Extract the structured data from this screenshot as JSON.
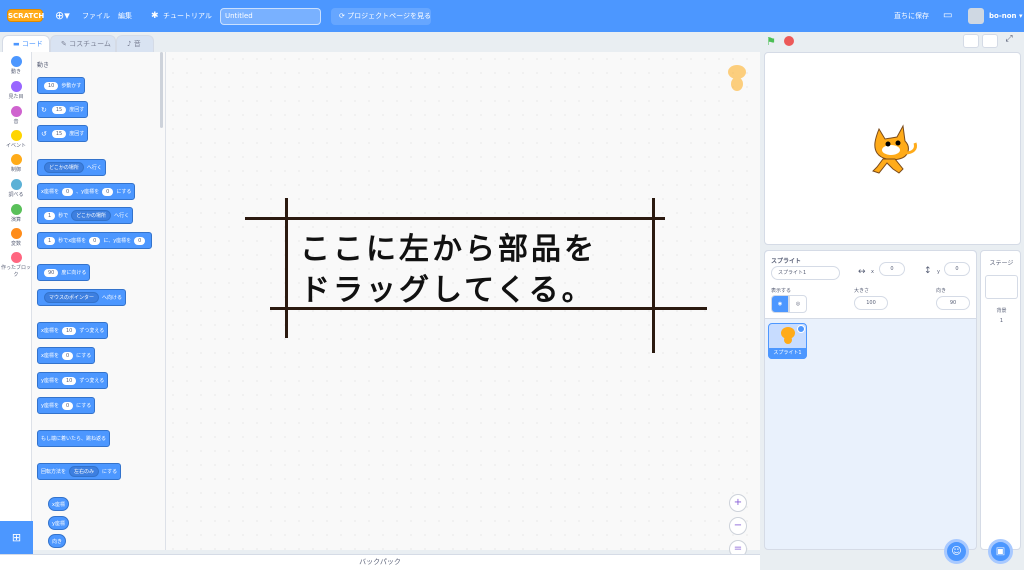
{
  "menu": {
    "logo": "SCRATCH",
    "file": "ファイル",
    "edit": "編集",
    "tutorial": "チュートリアル",
    "title_value": "Untitled",
    "project_page": "プロジェクトページを見る",
    "save": "直ちに保存",
    "user": "bo-non"
  },
  "tabs": {
    "code": "コード",
    "costume": "コスチューム",
    "sound": "音"
  },
  "categories": [
    {
      "label": "動き",
      "color": "#4c97ff"
    },
    {
      "label": "見た目",
      "color": "#9966ff"
    },
    {
      "label": "音",
      "color": "#cf63cf"
    },
    {
      "label": "イベント",
      "color": "#ffd500"
    },
    {
      "label": "制御",
      "color": "#ffab19"
    },
    {
      "label": "調べる",
      "color": "#5cb1d6"
    },
    {
      "label": "演算",
      "color": "#59c059"
    },
    {
      "label": "変数",
      "color": "#ff8c1a"
    },
    {
      "label": "作ったブロック",
      "color": "#ff6680"
    }
  ],
  "palette": {
    "heading": "動き",
    "b1": {
      "v": "10",
      "t": "歩動かす"
    },
    "b2": {
      "v": "15",
      "t": "度回す"
    },
    "b3": {
      "v": "15",
      "t": "度回す"
    },
    "b4": {
      "dd": "どこかの場所",
      "t": "へ行く"
    },
    "b5": {
      "t1": "x座標を",
      "v1": "0",
      "t2": "、y座標を",
      "v2": "0",
      "t3": "にする"
    },
    "b6": {
      "v": "1",
      "t1": "秒で",
      "dd": "どこかの場所",
      "t2": "へ行く"
    },
    "b7": {
      "v1": "1",
      "t1": "秒でx座標を",
      "v2": "0",
      "t2": "に、y座標を",
      "v3": "0"
    },
    "b8": {
      "v": "90",
      "t": "度に向ける"
    },
    "b9": {
      "dd": "マウスのポインター",
      "t": "へ向ける"
    },
    "b10": {
      "t1": "x座標を",
      "v": "10",
      "t2": "ずつ変える"
    },
    "b11": {
      "t1": "x座標を",
      "v": "0",
      "t2": "にする"
    },
    "b12": {
      "t1": "y座標を",
      "v": "10",
      "t2": "ずつ変える"
    },
    "b13": {
      "t1": "y座標を",
      "v": "0",
      "t2": "にする"
    },
    "b14": {
      "t": "もし端に着いたら、跳ね返る"
    },
    "b15": {
      "t1": "回転方法を",
      "dd": "左右のみ",
      "t2": "にする"
    },
    "r1": "x座標",
    "r2": "y座標",
    "r3": "向き"
  },
  "annotation": {
    "line1": "ここに左から部品を",
    "line2": "ドラッグしてくる。"
  },
  "backpack": "バックパック",
  "sprite": {
    "heading": "スプライト",
    "name": "スプライト1",
    "x_label": "x",
    "x": "0",
    "y_label": "y",
    "y": "0",
    "show_label": "表示する",
    "size_label": "大きさ",
    "size": "100",
    "dir_label": "向き",
    "dir": "90",
    "thumb_label": "スプライト1"
  },
  "stage_panel": {
    "heading": "ステージ",
    "backdrop_label": "背景",
    "backdrop_count": "1"
  }
}
